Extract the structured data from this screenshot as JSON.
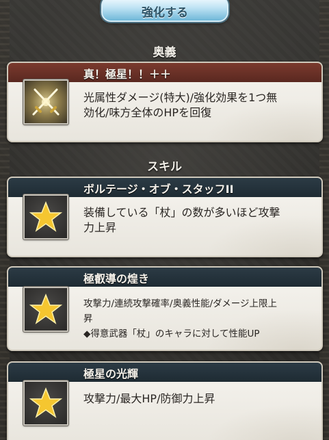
{
  "top_button": {
    "label": "強化する"
  },
  "sections": {
    "ougi_header": "奥義",
    "skill_header": "スキル"
  },
  "ougi": {
    "name": "真！極星！！＋＋",
    "description_line1": "光属性ダメージ(特大)/強化効果を1つ無",
    "description_line2": "効化/味方全体のHPを回復",
    "icon": "crossed-swords-icon"
  },
  "skills": [
    {
      "name": "ボルテージ・オブ・スタッフII",
      "description_line1": "装備している「杖」の数が多いほど攻撃",
      "description_line2": "力上昇",
      "icon": "star-icon"
    },
    {
      "name": "極叡導の煌き",
      "description_line1": "攻撃力/連続攻撃確率/奥義性能/ダメージ上限上",
      "description_line2": "昇",
      "description_line3": "◆得意武器「杖」のキャラに対して性能UP",
      "icon": "star-icon"
    },
    {
      "name": "極星の光輝",
      "description_line1": "攻撃力/最大HP/防御力上昇",
      "icon": "star-icon"
    }
  ],
  "colors": {
    "ougi_band": "#7a3a2e",
    "skill_band": "#2c3b45",
    "button": "#bfe3f4"
  }
}
